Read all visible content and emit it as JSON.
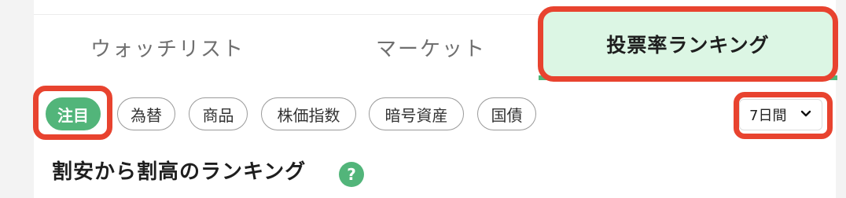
{
  "tabs": {
    "watchlist": "ウォッチリスト",
    "market": "マーケット",
    "ranking": "投票率ランキング"
  },
  "chips": [
    {
      "label": "注目",
      "active": true
    },
    {
      "label": "為替",
      "active": false
    },
    {
      "label": "商品",
      "active": false
    },
    {
      "label": "株価指数",
      "active": false
    },
    {
      "label": "暗号資産",
      "active": false
    },
    {
      "label": "国債",
      "active": false
    }
  ],
  "period_select": {
    "value": "7日間",
    "icon": "chevron-down-icon"
  },
  "section": {
    "title": "割安から割高のランキング",
    "help": "?",
    "help_icon": "question-icon"
  },
  "colors": {
    "accent": "#52b57a",
    "active_tab_bg": "#dcf6e4",
    "highlight": "#e8432f"
  }
}
